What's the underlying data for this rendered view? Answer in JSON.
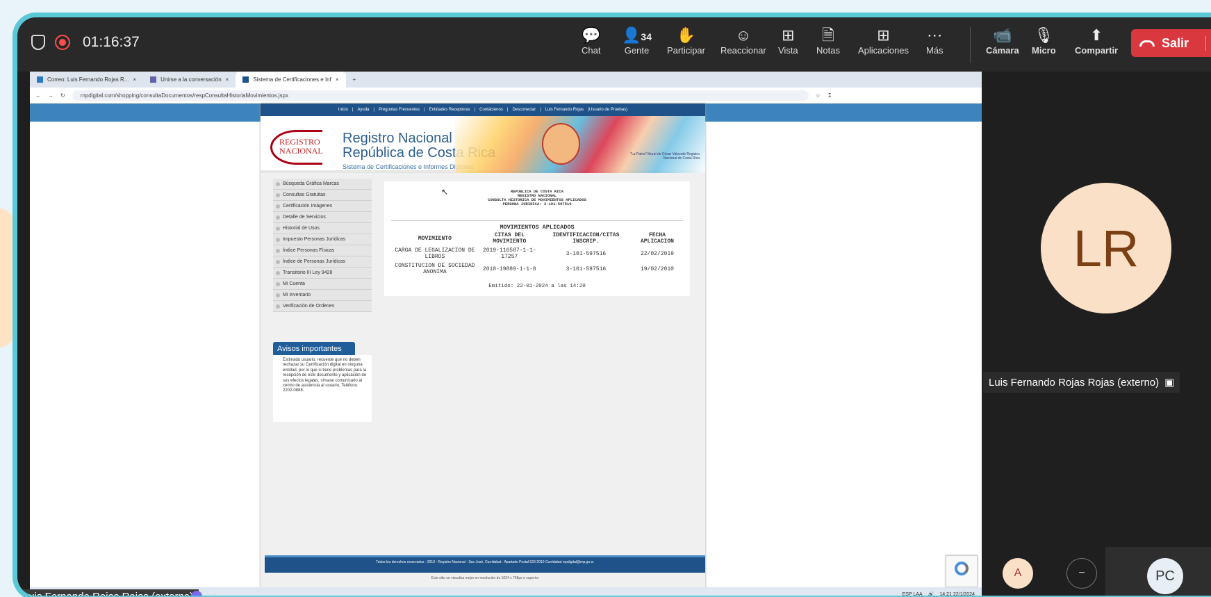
{
  "meeting": {
    "timer": "01:16:37",
    "toolbar": [
      {
        "label": "Chat",
        "icon": "chat-icon"
      },
      {
        "label": "Gente",
        "icon": "people-icon",
        "badge": "34"
      },
      {
        "label": "Participar",
        "icon": "raise-hand-icon"
      },
      {
        "label": "Reaccionar",
        "icon": "emoji-icon"
      },
      {
        "label": "Vista",
        "icon": "grid-icon"
      },
      {
        "label": "Notas",
        "icon": "notes-icon"
      },
      {
        "label": "Aplicaciones",
        "icon": "apps-icon"
      },
      {
        "label": "Más",
        "icon": "more-icon"
      }
    ],
    "controls": [
      {
        "label": "Cámara",
        "icon": "camera-off-icon"
      },
      {
        "label": "Micro",
        "icon": "mic-off-icon"
      },
      {
        "label": "Compartir",
        "icon": "share-icon"
      }
    ],
    "leave_label": "Salir",
    "shared_name_tag": "Luis Fernando Rojas Rojas (externo)",
    "participant": {
      "initials": "LR",
      "name": "Luis Fernando Rojas Rojas (externo)"
    },
    "small_avatars": [
      "A",
      "PC"
    ]
  },
  "browser": {
    "tabs": [
      "Correo: Luis Fernando Rojas R...",
      "Unirse a la conversación",
      "Sistema de Certificaciones e Inf"
    ],
    "url": "rnpdigital.com/shopping/consultaDocumentos/respConsultaHistoriaMovimientos.jspx"
  },
  "site": {
    "nav": [
      "Inicio",
      "Ayuda",
      "Preguntas Frecuentes",
      "Entidades Receptoras",
      "Contáctenos",
      "Desconectar",
      "Luis Fernando Rojas",
      "(Usuario de Pruebas)"
    ],
    "title1": "Registro Nacional",
    "title2": "República de Costa Rica",
    "subtitle": "Sistema de Certificaciones e Informes Digitales",
    "logo_text": "REGISTRO NACIONAL",
    "art_caption": "\"La Patria\" Mural de César Valverde Registro Nacional de Costa Rica",
    "menu": [
      "Búsqueda Gráfica Marcas",
      "Consultas Gratuitas",
      "Certificación Imágenes",
      "Detalle de Servicios",
      "Historial de Usos",
      "Impuesto Personas Jurídicas",
      "Índice Personas Físicas",
      "Índice de Personas Jurídicas",
      "Transitorio III Ley 9428",
      "Mi Cuenta",
      "Mi Inventario",
      "Verificación de Ordenes"
    ],
    "avisos_title": "Avisos importantes",
    "avisos_text": "Estimado usuario, recuerde que no deben rechazar su Certificación digital en ninguna entidad, por lo que si tiene problemas para la recepción de este documento y aplicación de sus efectos legales, sírvase comunicarlo al centro de asistencia al usuario, Teléfono. 2202-0888.",
    "report_header": [
      "REPUBLICA DE COSTA RICA",
      "REGISTRO NACIONAL",
      "CONSULTA HISTORICA DE MOVIMIENTOS APLICADOS",
      "PERSONA JURIDICA: 3-101-597516"
    ],
    "report_title": "MOVIMIENTOS APLICADOS",
    "columns": [
      "MOVIMIENTO",
      "CITAS DEL MOVIMIENTO",
      "IDENTIFICACION/CITAS INSCRIP.",
      "FECHA APLICACION"
    ],
    "rows": [
      [
        "CARGA DE LEGALIZACION DE LIBROS",
        "2019-116587-1-1-17257",
        "3-101-597516",
        "22/02/2019"
      ],
      [
        "CONSTITUCION DE SOCIEDAD ANONIMA",
        "2010-19889-1-1-0",
        "3-101-597516",
        "19/02/2010"
      ]
    ],
    "emitido": "Emitido: 22-01-2024 a las 14:20",
    "footer": "Todos los derechos reservados - 2013 - Registro Nacional - San José, Curridabat - Apartado Postal 523-2010 Curridabat rnpdigital@rnp.go.cr",
    "footnote": "Este sitio se visualiza mejor en resolución de 1024 x 768px o superior"
  },
  "taskbar": {
    "lang": "ESP LAA",
    "time": "14:21",
    "date": "22/1/2024"
  }
}
